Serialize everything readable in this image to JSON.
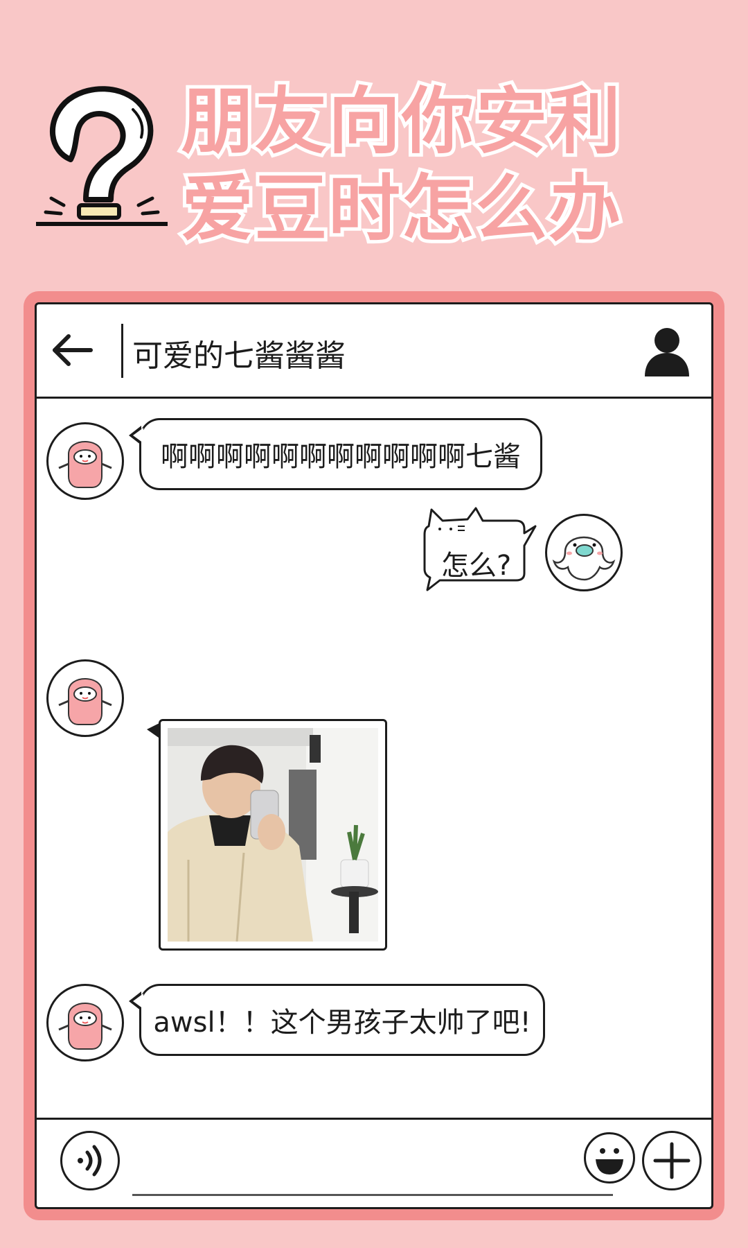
{
  "headline": {
    "line1": "朋友向你安利",
    "line2": "爱豆时怎么办"
  },
  "chat": {
    "title": "可爱的七酱酱酱",
    "messages": [
      {
        "side": "left",
        "type": "text",
        "text": "啊啊啊啊啊啊啊啊啊啊啊七酱"
      },
      {
        "side": "right",
        "type": "text",
        "text": "怎么?"
      },
      {
        "side": "left",
        "type": "image"
      },
      {
        "side": "left",
        "type": "text",
        "text": "awsl！！这个男孩子太帅了吧!"
      }
    ]
  },
  "icons": {
    "header": "question-bulb-icon",
    "back": "arrow-left-icon",
    "profile": "person-icon",
    "voice": "voice-icon",
    "emoji": "smiley-icon",
    "add": "plus-icon"
  },
  "colors": {
    "background": "#f9c7c7",
    "frame": "#f28d8d",
    "title_fill": "#f7a3a3",
    "ink": "#1c1c1c",
    "avatar_pink": "#f6a5a8",
    "seal_mint": "#7fd8cf"
  }
}
